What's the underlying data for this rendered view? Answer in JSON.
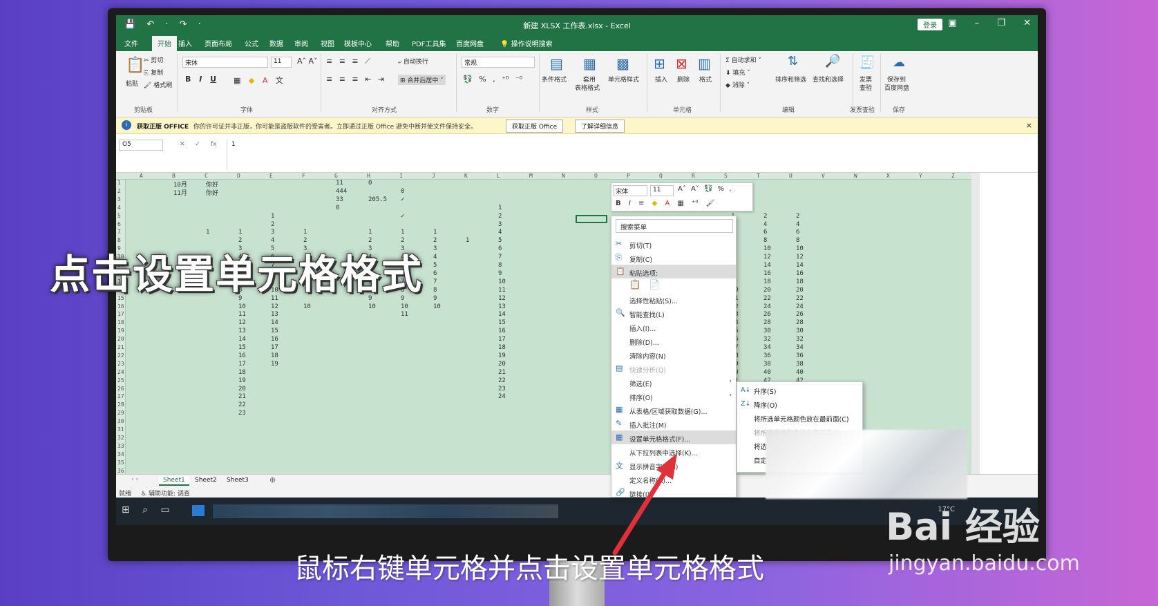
{
  "window": {
    "title": "新建 XLSX 工作表.xlsx - Excel",
    "login": "登录",
    "controls": "▣ – ❐ ✕"
  },
  "quick_access": "💾 ↶ · ↷ ·",
  "tabs": [
    "文件",
    "开始",
    "插入",
    "页面布局",
    "公式",
    "数据",
    "审阅",
    "视图",
    "模板中心",
    "帮助",
    "PDF工具集",
    "百度网盘",
    "操作说明搜索"
  ],
  "ribbon": {
    "clipboard": {
      "paste": "粘贴",
      "cut": "剪切",
      "copy": "复制",
      "painter": "格式刷",
      "label": "剪贴板"
    },
    "font": {
      "name": "宋体",
      "size": "11",
      "label": "字体"
    },
    "alignment": {
      "wrap": "自动换行",
      "merge": "合并后居中",
      "label": "对齐方式"
    },
    "number": {
      "format": "常规",
      "label": "数字"
    },
    "styles": {
      "cond": "条件格式",
      "table": "套用",
      "table2": "表格格式",
      "cell": "单元格样式",
      "label": "样式"
    },
    "cells": {
      "insert": "插入",
      "delete": "删除",
      "format": "格式",
      "label": "单元格"
    },
    "editing": {
      "sum": "自动求和",
      "fill": "填充",
      "clear": "消除",
      "sort": "排序和筛选",
      "find": "查找和选择",
      "label": "编辑"
    },
    "invoice": {
      "a": "发票",
      "b": "查验",
      "label": "发票查验"
    },
    "save": {
      "a": "保存到",
      "b": "百度网盘",
      "label": "保存"
    }
  },
  "infobar": {
    "bold": "获取正版 OFFICE",
    "message": "你的许可证并非正版，你可能是盗版软件的受害者。立即通过正版 Office 避免中断并使文件保持安全。",
    "btn1": "获取正版 Office",
    "btn2": "了解详细信息"
  },
  "formula_bar": {
    "name_box": "O5",
    "fx": "✕ ✓ fx",
    "value": "1"
  },
  "columns": [
    "A",
    "B",
    "C",
    "D",
    "E",
    "F",
    "G",
    "H",
    "I",
    "J",
    "K",
    "L",
    "M",
    "N",
    "O",
    "P",
    "Q",
    "R",
    "S",
    "T",
    "U",
    "V",
    "W",
    "X",
    "Y",
    "Z"
  ],
  "cells": [
    {
      "r": 1,
      "c": "B",
      "v": "10月"
    },
    {
      "r": 1,
      "c": "C",
      "v": "你好"
    },
    {
      "r": 1,
      "c": "G",
      "v": "11"
    },
    {
      "r": 1,
      "c": "H",
      "v": "0"
    },
    {
      "r": 2,
      "c": "B",
      "v": "11月"
    },
    {
      "r": 2,
      "c": "C",
      "v": "你好"
    },
    {
      "r": 2,
      "c": "G",
      "v": "444"
    },
    {
      "r": 2,
      "c": "I",
      "v": "0"
    },
    {
      "r": 3,
      "c": "G",
      "v": "33"
    },
    {
      "r": 3,
      "c": "H",
      "v": "205.5"
    },
    {
      "r": 3,
      "c": "I",
      "v": "✓"
    },
    {
      "r": 4,
      "c": "G",
      "v": "0"
    },
    {
      "r": 4,
      "c": "L",
      "v": "1"
    },
    {
      "r": 5,
      "c": "E",
      "v": "1"
    },
    {
      "r": 5,
      "c": "I",
      "v": "✓"
    },
    {
      "r": 5,
      "c": "L",
      "v": "2"
    },
    {
      "r": 6,
      "c": "E",
      "v": "2"
    },
    {
      "r": 6,
      "c": "L",
      "v": "3"
    },
    {
      "r": 7,
      "c": "C",
      "v": "1"
    },
    {
      "r": 7,
      "c": "D",
      "v": "1"
    },
    {
      "r": 7,
      "c": "E",
      "v": "3"
    },
    {
      "r": 7,
      "c": "F",
      "v": "1"
    },
    {
      "r": 7,
      "c": "H",
      "v": "1"
    },
    {
      "r": 7,
      "c": "I",
      "v": "1"
    },
    {
      "r": 7,
      "c": "J",
      "v": "1"
    },
    {
      "r": 7,
      "c": "L",
      "v": "4"
    },
    {
      "r": 8,
      "c": "D",
      "v": "2"
    },
    {
      "r": 8,
      "c": "E",
      "v": "4"
    },
    {
      "r": 8,
      "c": "F",
      "v": "2"
    },
    {
      "r": 8,
      "c": "H",
      "v": "2"
    },
    {
      "r": 8,
      "c": "I",
      "v": "2"
    },
    {
      "r": 8,
      "c": "J",
      "v": "2"
    },
    {
      "r": 8,
      "c": "K",
      "v": "1"
    },
    {
      "r": 8,
      "c": "L",
      "v": "5"
    },
    {
      "r": 9,
      "c": "D",
      "v": "3"
    },
    {
      "r": 9,
      "c": "E",
      "v": "5"
    },
    {
      "r": 9,
      "c": "F",
      "v": "3"
    },
    {
      "r": 9,
      "c": "H",
      "v": "3"
    },
    {
      "r": 9,
      "c": "I",
      "v": "3"
    },
    {
      "r": 9,
      "c": "J",
      "v": "3"
    },
    {
      "r": 9,
      "c": "L",
      "v": "6"
    },
    {
      "r": 10,
      "c": "D",
      "v": "4"
    },
    {
      "r": 10,
      "c": "E",
      "v": "6"
    },
    {
      "r": 10,
      "c": "H",
      "v": "4"
    },
    {
      "r": 10,
      "c": "I",
      "v": "4"
    },
    {
      "r": 10,
      "c": "J",
      "v": "4"
    },
    {
      "r": 10,
      "c": "L",
      "v": "7"
    },
    {
      "r": 11,
      "c": "D",
      "v": "5"
    },
    {
      "r": 11,
      "c": "E",
      "v": "7"
    },
    {
      "r": 11,
      "c": "H",
      "v": "5"
    },
    {
      "r": 11,
      "c": "I",
      "v": "5"
    },
    {
      "r": 11,
      "c": "J",
      "v": "5"
    },
    {
      "r": 11,
      "c": "L",
      "v": "8"
    },
    {
      "r": 12,
      "c": "D",
      "v": "6"
    },
    {
      "r": 12,
      "c": "E",
      "v": "8"
    },
    {
      "r": 12,
      "c": "H",
      "v": "6"
    },
    {
      "r": 12,
      "c": "I",
      "v": "6"
    },
    {
      "r": 12,
      "c": "J",
      "v": "6"
    },
    {
      "r": 12,
      "c": "L",
      "v": "9"
    },
    {
      "r": 13,
      "c": "D",
      "v": "7"
    },
    {
      "r": 13,
      "c": "E",
      "v": "9"
    },
    {
      "r": 13,
      "c": "H",
      "v": "7"
    },
    {
      "r": 13,
      "c": "I",
      "v": "7"
    },
    {
      "r": 13,
      "c": "J",
      "v": "7"
    },
    {
      "r": 13,
      "c": "L",
      "v": "10"
    },
    {
      "r": 14,
      "c": "D",
      "v": "8"
    },
    {
      "r": 14,
      "c": "E",
      "v": "10"
    },
    {
      "r": 14,
      "c": "H",
      "v": "8"
    },
    {
      "r": 14,
      "c": "I",
      "v": "8"
    },
    {
      "r": 14,
      "c": "J",
      "v": "8"
    },
    {
      "r": 14,
      "c": "L",
      "v": "11"
    },
    {
      "r": 15,
      "c": "D",
      "v": "9"
    },
    {
      "r": 15,
      "c": "E",
      "v": "11"
    },
    {
      "r": 15,
      "c": "H",
      "v": "9"
    },
    {
      "r": 15,
      "c": "I",
      "v": "9"
    },
    {
      "r": 15,
      "c": "J",
      "v": "9"
    },
    {
      "r": 15,
      "c": "L",
      "v": "12"
    },
    {
      "r": 16,
      "c": "D",
      "v": "10"
    },
    {
      "r": 16,
      "c": "E",
      "v": "12"
    },
    {
      "r": 16,
      "c": "F",
      "v": "10"
    },
    {
      "r": 16,
      "c": "H",
      "v": "10"
    },
    {
      "r": 16,
      "c": "I",
      "v": "10"
    },
    {
      "r": 16,
      "c": "J",
      "v": "10"
    },
    {
      "r": 16,
      "c": "L",
      "v": "13"
    },
    {
      "r": 17,
      "c": "D",
      "v": "11"
    },
    {
      "r": 17,
      "c": "E",
      "v": "13"
    },
    {
      "r": 17,
      "c": "I",
      "v": "11"
    },
    {
      "r": 17,
      "c": "L",
      "v": "14"
    },
    {
      "r": 18,
      "c": "D",
      "v": "12"
    },
    {
      "r": 18,
      "c": "E",
      "v": "14"
    },
    {
      "r": 18,
      "c": "L",
      "v": "15"
    },
    {
      "r": 19,
      "c": "D",
      "v": "13"
    },
    {
      "r": 19,
      "c": "E",
      "v": "15"
    },
    {
      "r": 19,
      "c": "L",
      "v": "16"
    },
    {
      "r": 20,
      "c": "D",
      "v": "14"
    },
    {
      "r": 20,
      "c": "E",
      "v": "16"
    },
    {
      "r": 20,
      "c": "L",
      "v": "17"
    },
    {
      "r": 21,
      "c": "D",
      "v": "15"
    },
    {
      "r": 21,
      "c": "E",
      "v": "17"
    },
    {
      "r": 21,
      "c": "L",
      "v": "18"
    },
    {
      "r": 22,
      "c": "D",
      "v": "16"
    },
    {
      "r": 22,
      "c": "E",
      "v": "18"
    },
    {
      "r": 22,
      "c": "L",
      "v": "19"
    },
    {
      "r": 23,
      "c": "D",
      "v": "17"
    },
    {
      "r": 23,
      "c": "E",
      "v": "19"
    },
    {
      "r": 23,
      "c": "L",
      "v": "20"
    },
    {
      "r": 24,
      "c": "D",
      "v": "18"
    },
    {
      "r": 24,
      "c": "L",
      "v": "21"
    },
    {
      "r": 25,
      "c": "D",
      "v": "19"
    },
    {
      "r": 25,
      "c": "L",
      "v": "22"
    },
    {
      "r": 26,
      "c": "D",
      "v": "20"
    },
    {
      "r": 26,
      "c": "L",
      "v": "23"
    },
    {
      "r": 27,
      "c": "D",
      "v": "21"
    },
    {
      "r": 27,
      "c": "L",
      "v": "24"
    },
    {
      "r": 28,
      "c": "D",
      "v": "22"
    },
    {
      "r": 29,
      "c": "D",
      "v": "23"
    }
  ],
  "right_cols": [
    {
      "s": "1",
      "t": "2",
      "u": "2"
    },
    {
      "s": "2",
      "t": "4",
      "u": "4"
    },
    {
      "s": "3",
      "t": "6",
      "u": "6"
    },
    {
      "s": "4",
      "t": "8",
      "u": "8"
    },
    {
      "s": "5",
      "t": "10",
      "u": "10"
    },
    {
      "s": "6",
      "t": "12",
      "u": "12"
    },
    {
      "s": "7",
      "t": "14",
      "u": "14"
    },
    {
      "s": "8",
      "t": "16",
      "u": "16"
    },
    {
      "s": "9",
      "t": "18",
      "u": "18"
    },
    {
      "s": "10",
      "t": "20",
      "u": "20"
    },
    {
      "s": "11",
      "t": "22",
      "u": "22"
    },
    {
      "s": "12",
      "t": "24",
      "u": "24"
    },
    {
      "s": "13",
      "t": "26",
      "u": "26"
    },
    {
      "s": "14",
      "t": "28",
      "u": "28"
    },
    {
      "s": "15",
      "t": "30",
      "u": "30"
    },
    {
      "s": "16",
      "t": "32",
      "u": "32"
    },
    {
      "s": "17",
      "t": "34",
      "u": "34"
    },
    {
      "s": "18",
      "t": "36",
      "u": "36"
    },
    {
      "s": "19",
      "t": "38",
      "u": "38"
    },
    {
      "s": "20",
      "t": "40",
      "u": "40"
    },
    {
      "s": "21",
      "t": "42",
      "u": "42"
    }
  ],
  "mini_toolbar": {
    "font": "宋体",
    "size": "11"
  },
  "context_menu": {
    "search": "搜索菜单",
    "items": [
      {
        "label": "剪切(T)",
        "icon": "✂"
      },
      {
        "label": "复制(C)",
        "icon": "⎘"
      },
      {
        "label": "粘贴选项:",
        "icon": "📋",
        "hl": true
      },
      {
        "label": "",
        "icon": ""
      },
      {
        "label": "选择性粘贴(S)...",
        "icon": ""
      },
      {
        "label": "智能查找(L)",
        "icon": "🔍"
      },
      {
        "label": "插入(I)...",
        "icon": ""
      },
      {
        "label": "删除(D)...",
        "icon": ""
      },
      {
        "label": "清除内容(N)",
        "icon": ""
      },
      {
        "label": "快速分析(Q)",
        "icon": "▤",
        "dis": true
      },
      {
        "label": "筛选(E)",
        "icon": "",
        "arr": true
      },
      {
        "label": "排序(O)",
        "icon": "",
        "arr": true
      },
      {
        "label": "从表格/区域获取数据(G)...",
        "icon": "▦"
      },
      {
        "label": "插入批注(M)",
        "icon": "✎"
      },
      {
        "label": "设置单元格格式(F)...",
        "icon": "▦",
        "sel": true
      },
      {
        "label": "从下拉列表中选择(K)...",
        "icon": ""
      },
      {
        "label": "显示拼音字段(S)",
        "icon": "文"
      },
      {
        "label": "定义名称(A)...",
        "icon": ""
      },
      {
        "label": "链接(I)",
        "icon": "🔗"
      }
    ]
  },
  "sort_submenu": [
    "升序(S)",
    "降序(O)",
    "将所选单元格颜色放在最前面(C)",
    "将所选字体颜色放在最前面(F)",
    "将选",
    "自定"
  ],
  "sheets": [
    "Sheet1",
    "Sheet2",
    "Sheet3"
  ],
  "status": {
    "ready": "就绪",
    "access": "辅助功能: 调查"
  },
  "taskbar": {
    "temp": "17°C"
  },
  "overlay_title": "点击设置单元格格式",
  "caption": "鼠标右键单元格并点击设置单元格格式",
  "watermark": {
    "logo": "Bai 经验",
    "url": "jingyan.baidu.com"
  },
  "colors": {
    "excel_green": "#217346",
    "grid_bg": "#c7e2cf",
    "arrow": "#e0303a"
  }
}
